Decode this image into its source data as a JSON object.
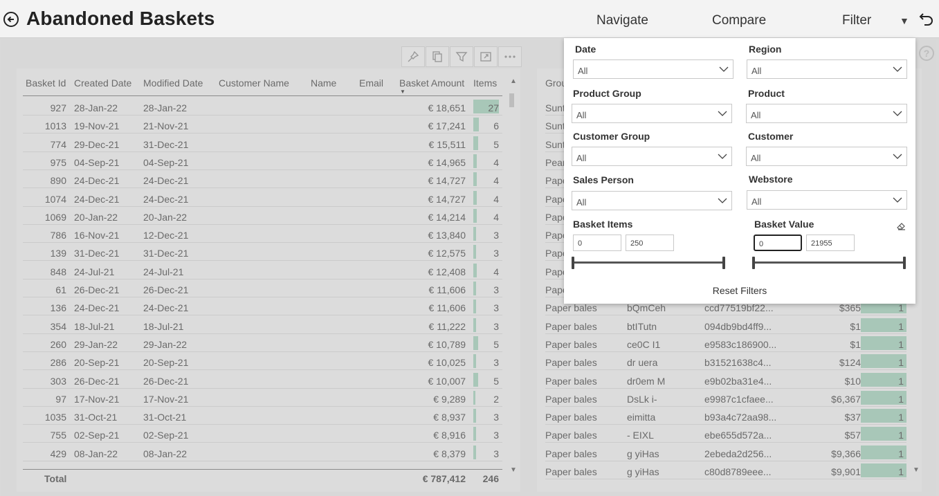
{
  "header": {
    "title": "Abandoned Baskets",
    "nav": {
      "navigate": "Navigate",
      "compare": "Compare",
      "filter": "Filter"
    },
    "filter_caret": "▼"
  },
  "help": {
    "label": "?"
  },
  "left_table": {
    "columns": [
      "Basket Id",
      "Created Date",
      "Modified Date",
      "Customer Name",
      "Name",
      "Email",
      "Basket Amount",
      "Items"
    ],
    "rows": [
      {
        "id": "927",
        "created": "28-Jan-22",
        "modified": "28-Jan-22",
        "amount": "€ 18,651",
        "items": "27"
      },
      {
        "id": "1013",
        "created": "19-Nov-21",
        "modified": "21-Nov-21",
        "amount": "€ 17,241",
        "items": "6"
      },
      {
        "id": "774",
        "created": "29-Dec-21",
        "modified": "31-Dec-21",
        "amount": "€ 15,511",
        "items": "5"
      },
      {
        "id": "975",
        "created": "04-Sep-21",
        "modified": "04-Sep-21",
        "amount": "€ 14,965",
        "items": "4"
      },
      {
        "id": "890",
        "created": "24-Dec-21",
        "modified": "24-Dec-21",
        "amount": "€ 14,727",
        "items": "4"
      },
      {
        "id": "1074",
        "created": "24-Dec-21",
        "modified": "24-Dec-21",
        "amount": "€ 14,727",
        "items": "4"
      },
      {
        "id": "1069",
        "created": "20-Jan-22",
        "modified": "20-Jan-22",
        "amount": "€ 14,214",
        "items": "4"
      },
      {
        "id": "786",
        "created": "16-Nov-21",
        "modified": "12-Dec-21",
        "amount": "€ 13,840",
        "items": "3"
      },
      {
        "id": "139",
        "created": "31-Dec-21",
        "modified": "31-Dec-21",
        "amount": "€ 12,575",
        "items": "3"
      },
      {
        "id": "848",
        "created": "24-Jul-21",
        "modified": "24-Jul-21",
        "amount": "€ 12,408",
        "items": "4"
      },
      {
        "id": "61",
        "created": "26-Dec-21",
        "modified": "26-Dec-21",
        "amount": "€ 11,606",
        "items": "3"
      },
      {
        "id": "136",
        "created": "24-Dec-21",
        "modified": "24-Dec-21",
        "amount": "€ 11,606",
        "items": "3"
      },
      {
        "id": "354",
        "created": "18-Jul-21",
        "modified": "18-Jul-21",
        "amount": "€ 11,222",
        "items": "3"
      },
      {
        "id": "260",
        "created": "29-Jan-22",
        "modified": "29-Jan-22",
        "amount": "€ 10,789",
        "items": "5"
      },
      {
        "id": "286",
        "created": "20-Sep-21",
        "modified": "20-Sep-21",
        "amount": "€ 10,025",
        "items": "3"
      },
      {
        "id": "303",
        "created": "26-Dec-21",
        "modified": "26-Dec-21",
        "amount": "€ 10,007",
        "items": "5"
      },
      {
        "id": "97",
        "created": "17-Nov-21",
        "modified": "17-Nov-21",
        "amount": "€ 9,289",
        "items": "2"
      },
      {
        "id": "1035",
        "created": "31-Oct-21",
        "modified": "31-Oct-21",
        "amount": "€ 8,937",
        "items": "3"
      },
      {
        "id": "755",
        "created": "02-Sep-21",
        "modified": "02-Sep-21",
        "amount": "€ 8,916",
        "items": "3"
      },
      {
        "id": "429",
        "created": "08-Jan-22",
        "modified": "08-Jan-22",
        "amount": "€ 8,379",
        "items": "3"
      }
    ],
    "total_label": "Total",
    "total_amount": "€ 787,412",
    "total_items": "246"
  },
  "right_table": {
    "header_partial": "Grou",
    "rows": [
      {
        "group": "Sunt",
        "name": "",
        "id": "",
        "amount": "",
        "items": ""
      },
      {
        "group": "Sunt",
        "name": "",
        "id": "",
        "amount": "",
        "items": ""
      },
      {
        "group": "Sunt",
        "name": "",
        "id": "",
        "amount": "",
        "items": ""
      },
      {
        "group": "Pear",
        "name": "",
        "id": "",
        "amount": "",
        "items": ""
      },
      {
        "group": "Pape",
        "name": "",
        "id": "",
        "amount": "",
        "items": ""
      },
      {
        "group": "Pape",
        "name": "",
        "id": "",
        "amount": "",
        "items": ""
      },
      {
        "group": "Pape",
        "name": "",
        "id": "",
        "amount": "",
        "items": ""
      },
      {
        "group": "Pape",
        "name": "",
        "id": "",
        "amount": "",
        "items": ""
      },
      {
        "group": "Pape",
        "name": "",
        "id": "",
        "amount": "",
        "items": ""
      },
      {
        "group": "Pape",
        "name": "",
        "id": "",
        "amount": "",
        "items": ""
      },
      {
        "group": "Pape",
        "name": "",
        "id": "",
        "amount": "",
        "items": ""
      },
      {
        "group": "Paper bales",
        "name": "bQmCeh",
        "id": "ccd77519bf22...",
        "amount": "$365",
        "items": "1"
      },
      {
        "group": "Paper bales",
        "name": "btITutn",
        "id": "094db9bd4ff9...",
        "amount": "$1",
        "items": "1"
      },
      {
        "group": "Paper bales",
        "name": "ce0C I1",
        "id": "e9583c186900...",
        "amount": "$1",
        "items": "1"
      },
      {
        "group": "Paper bales",
        "name": "dr uera",
        "id": "b31521638c4...",
        "amount": "$124",
        "items": "1"
      },
      {
        "group": "Paper bales",
        "name": "dr0em M",
        "id": "e9b02ba31e4...",
        "amount": "$10",
        "items": "1"
      },
      {
        "group": "Paper bales",
        "name": "DsLk i-",
        "id": "e9987c1cfaee...",
        "amount": "$6,367",
        "items": "1"
      },
      {
        "group": "Paper bales",
        "name": "eimitta",
        "id": "b93a4c72aa98...",
        "amount": "$37",
        "items": "1"
      },
      {
        "group": "Paper bales",
        "name": "- EIXL",
        "id": "ebe655d572a...",
        "amount": "$57",
        "items": "1"
      },
      {
        "group": "Paper bales",
        "name": "g yiHas",
        "id": "2ebeda2d256...",
        "amount": "$9,366",
        "items": "1"
      },
      {
        "group": "Paper bales",
        "name": "g yiHas",
        "id": "c80d8789eee...",
        "amount": "$9,901",
        "items": "1"
      }
    ]
  },
  "filter_panel": {
    "date": {
      "label": "Date",
      "value": "All"
    },
    "region": {
      "label": "Region",
      "value": "All"
    },
    "product_group": {
      "label": "Product Group",
      "value": "All"
    },
    "product": {
      "label": "Product",
      "value": "All"
    },
    "customer_group": {
      "label": "Customer Group",
      "value": "All"
    },
    "customer": {
      "label": "Customer",
      "value": "All"
    },
    "sales_person": {
      "label": "Sales Person",
      "value": "All"
    },
    "webstore": {
      "label": "Webstore",
      "value": "All"
    },
    "basket_items": {
      "label": "Basket Items",
      "min": "0",
      "max": "250"
    },
    "basket_value": {
      "label": "Basket Value",
      "min": "0",
      "max": "21955"
    },
    "reset_label": "Reset Filters"
  },
  "colors": {
    "data_bar": "#a8c7b8",
    "panel_bg": "#ffffff",
    "canvas_bg": "#d8d8d8"
  }
}
